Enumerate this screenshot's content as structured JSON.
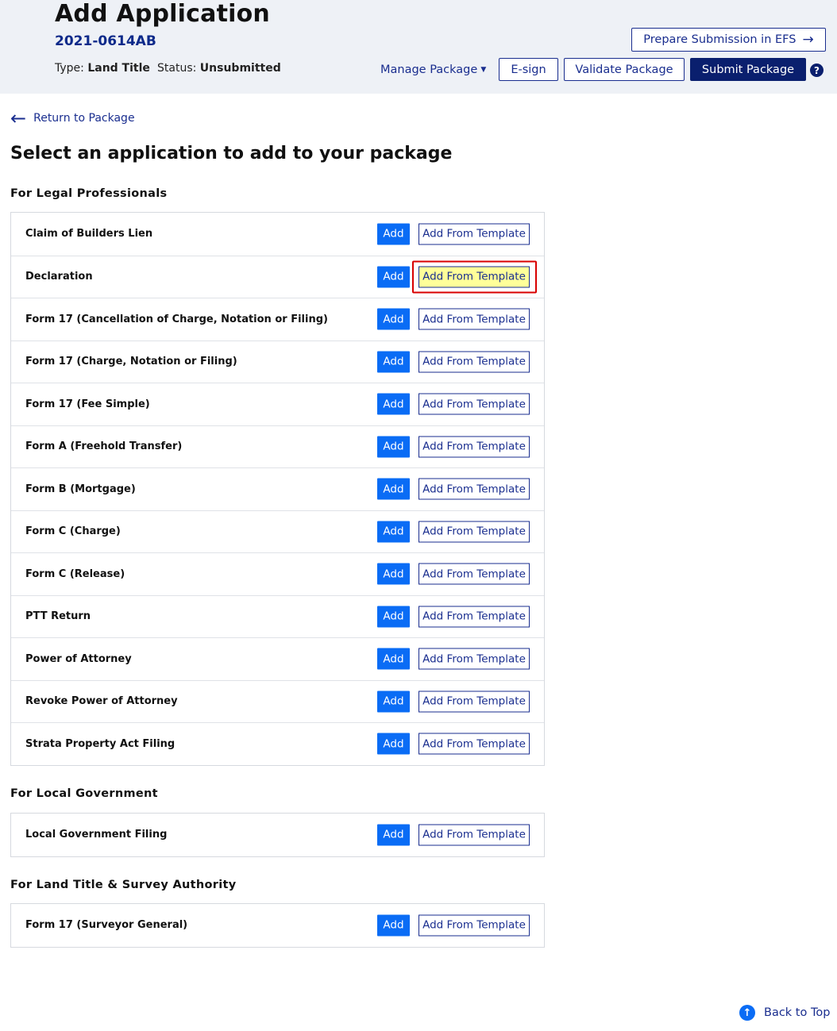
{
  "header": {
    "title": "Add Application",
    "package_number": "2021-0614AB",
    "type_label": "Type:",
    "type_value": "Land Title",
    "status_label": "Status:",
    "status_value": "Unsubmitted",
    "prepare_label": "Prepare Submission in EFS",
    "manage_label": "Manage Package",
    "esign_label": "E-sign",
    "validate_label": "Validate Package",
    "submit_label": "Submit Package",
    "help_glyph": "?"
  },
  "nav": {
    "return_label": "Return to Package"
  },
  "main": {
    "heading": "Select an application to add to your package",
    "add_label": "Add",
    "template_label": "Add From Template"
  },
  "sections": [
    {
      "title": "For Legal Professionals",
      "items": [
        "Claim of Builders Lien",
        "Declaration",
        "Form 17 (Cancellation of Charge, Notation or Filing)",
        "Form 17 (Charge, Notation or Filing)",
        "Form 17 (Fee Simple)",
        "Form A (Freehold Transfer)",
        "Form B (Mortgage)",
        "Form C (Charge)",
        "Form C (Release)",
        "PTT Return",
        "Power of Attorney",
        "Revoke Power of Attorney",
        "Strata Property Act Filing"
      ]
    },
    {
      "title": "For Local Government",
      "items": [
        "Local Government Filing"
      ]
    },
    {
      "title": "For Land Title & Survey Authority",
      "items": [
        "Form 17 (Surveyor General)"
      ]
    }
  ],
  "highlighted_item": "Declaration",
  "footer": {
    "back_to_top_label": "Back to Top"
  },
  "colors": {
    "header_bg": "#eef1f6",
    "navy": "#0a1f6e",
    "link_blue": "#1a2e8f",
    "add_blue": "#0a6cf5",
    "highlight_fill": "#ffff99",
    "highlight_border": "#d80000"
  },
  "icons": {
    "prepare_arrow": "arrow-right-icon",
    "manage_caret": "caret-down-icon",
    "return_arrow": "arrow-left-icon",
    "back_top": "arrow-up-circle-icon",
    "help": "question-circle-icon"
  }
}
